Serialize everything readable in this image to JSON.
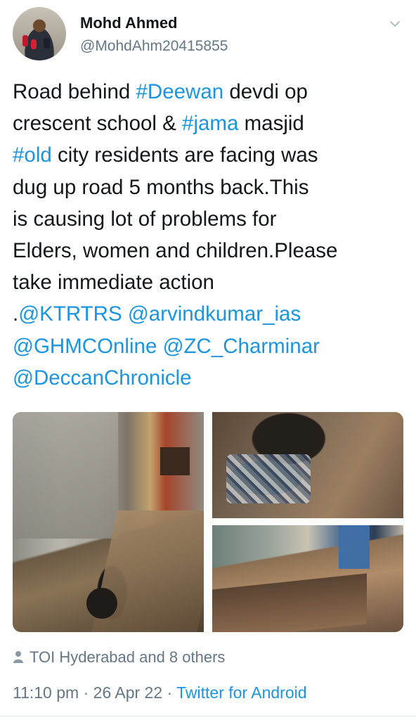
{
  "author": {
    "name": "Mohd Ahmed",
    "handle": "@MohdAhm20415855",
    "avatar_icon": "profile-photo"
  },
  "tweet": {
    "lines": [
      [
        {
          "t": "Road behind ",
          "link": false
        },
        {
          "t": "#Deewan",
          "link": true
        },
        {
          "t": " devdi op",
          "link": false
        }
      ],
      [
        {
          "t": "crescent school & ",
          "link": false
        },
        {
          "t": "#jama",
          "link": true
        },
        {
          "t": " masjid",
          "link": false
        }
      ],
      [
        {
          "t": "#old",
          "link": true
        },
        {
          "t": " city residents are facing was",
          "link": false
        }
      ],
      [
        {
          "t": "dug up road 5 months back.This",
          "link": false
        }
      ],
      [
        {
          "t": "is causing lot of problems for",
          "link": false
        }
      ],
      [
        {
          "t": "Elders, women and children.Please",
          "link": false
        }
      ],
      [
        {
          "t": "take immediate action",
          "link": false
        }
      ],
      [
        {
          "t": ".",
          "link": false
        },
        {
          "t": "@KTRTRS",
          "link": true
        },
        {
          "t": " ",
          "link": false
        },
        {
          "t": "@arvindkumar_ias",
          "link": true
        }
      ],
      [
        {
          "t": "@GHMCOnline",
          "link": true
        },
        {
          "t": " ",
          "link": false
        },
        {
          "t": "@ZC_Charminar",
          "link": true
        }
      ],
      [
        {
          "t": "@DeccanChronicle",
          "link": true
        }
      ]
    ]
  },
  "media": [
    {
      "name": "dug-up-street-photo",
      "icon": "photo"
    },
    {
      "name": "exposed-pipes-photo",
      "icon": "photo"
    },
    {
      "name": "trench-lane-photo",
      "icon": "photo"
    }
  ],
  "social": {
    "liked_by": "TOI Hyderabad and 8 others",
    "icon": "person-icon"
  },
  "meta": {
    "time": "11:10 pm",
    "sep1": " · ",
    "date": "26 Apr 22",
    "sep2": " · ",
    "source": "Twitter for Android"
  },
  "colors": {
    "link": "#1b95e0",
    "secondary_text": "#657786",
    "primary_text": "#14171a"
  }
}
